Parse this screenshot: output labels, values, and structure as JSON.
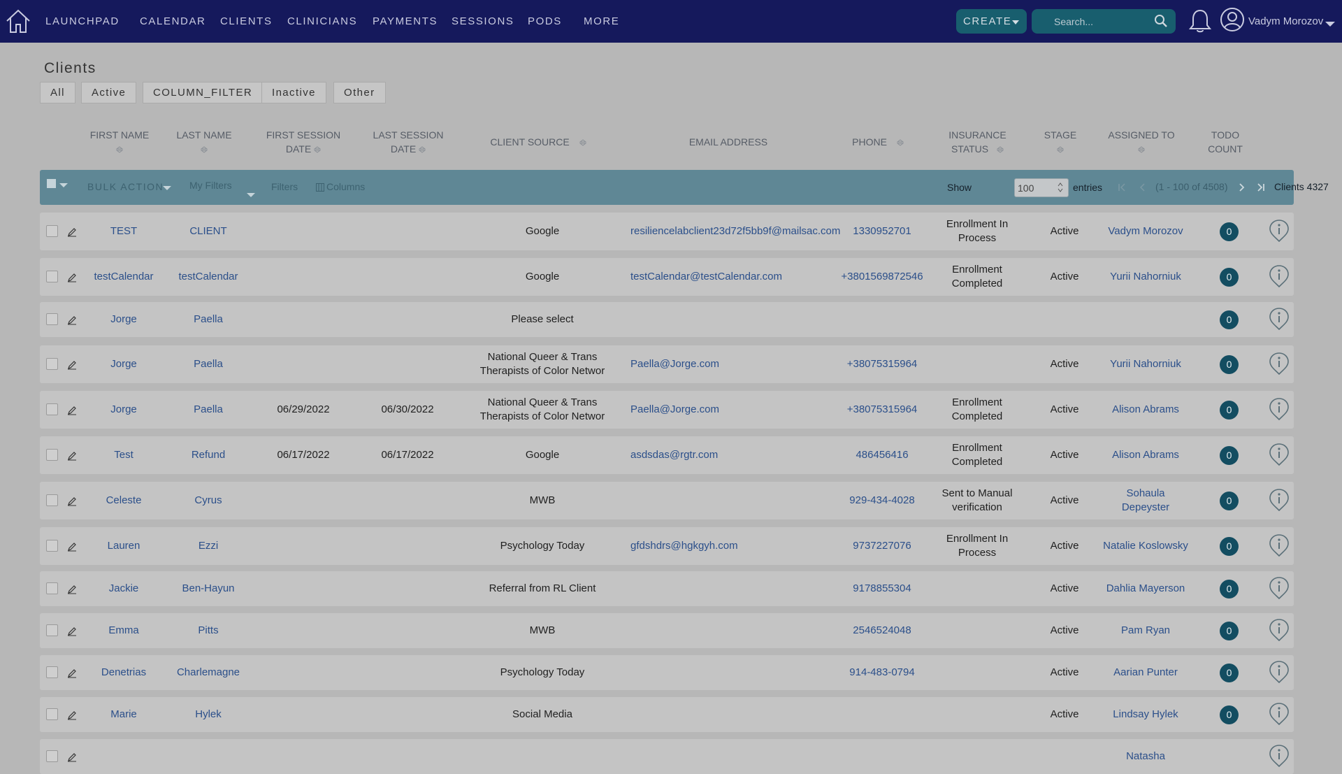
{
  "nav": {
    "items": [
      "LAUNCHPAD",
      "CALENDAR",
      "CLIENTS",
      "CLINICIANS",
      "PAYMENTS",
      "SESSIONS",
      "PODS",
      "MORE"
    ],
    "create_label": "CREATE",
    "search_placeholder": "Search...",
    "user_name": "Vadym Morozov"
  },
  "page": {
    "title": "Clients",
    "filter_tabs": [
      "All",
      "Active",
      "COLUMN_FILTER",
      "Inactive",
      "Other"
    ]
  },
  "columns": {
    "first_name": "FIRST NAME",
    "last_name": "LAST NAME",
    "first_session_1": "FIRST SESSION",
    "first_session_2": "DATE",
    "last_session_1": "LAST SESSION",
    "last_session_2": "DATE",
    "client_source": "CLIENT SOURCE",
    "email": "EMAIL ADDRESS",
    "phone": "PHONE",
    "insurance_1": "INSURANCE",
    "insurance_2": "STATUS",
    "stage": "STAGE",
    "assigned_to": "ASSIGNED TO",
    "todo_1": "TODO",
    "todo_2": "COUNT"
  },
  "toolbar": {
    "bulk_action": "BULK ACTION",
    "my_filters": "My Filters",
    "filters": "Filters",
    "columns": "Columns",
    "show_label": "Show",
    "show_value": "100",
    "entries_label": "entries",
    "range": "(1 - 100 of 4508)",
    "clients_count": "Clients 4327"
  },
  "rows": [
    {
      "first": "TEST",
      "last": "CLIENT",
      "fsd": "",
      "lsd": "",
      "source": [
        "Google"
      ],
      "email": "resiliencelabclient23d72f5bb9f@mailsac.com",
      "phone": "1330952701",
      "insurance": [
        "Enrollment In",
        "Process"
      ],
      "stage": "Active",
      "assigned": [
        "Vadym Morozov"
      ],
      "todo": "0"
    },
    {
      "first": "testCalendar",
      "last": "testCalendar",
      "fsd": "",
      "lsd": "",
      "source": [
        "Google"
      ],
      "email": "testCalendar@testCalendar.com",
      "phone": "+3801569872546",
      "insurance": [
        "Enrollment",
        "Completed"
      ],
      "stage": "Active",
      "assigned": [
        "Yurii Nahorniuk"
      ],
      "todo": "0"
    },
    {
      "first": "Jorge",
      "last": "Paella",
      "fsd": "",
      "lsd": "",
      "source": [
        "Please select"
      ],
      "email": "",
      "phone": "",
      "insurance": [],
      "stage": "",
      "assigned": [],
      "todo": "0"
    },
    {
      "first": "Jorge",
      "last": "Paella",
      "fsd": "",
      "lsd": "",
      "source": [
        "National Queer & Trans",
        "Therapists of Color Networ"
      ],
      "email": "Paella@Jorge.com",
      "phone": "+38075315964",
      "insurance": [],
      "stage": "Active",
      "assigned": [
        "Yurii Nahorniuk"
      ],
      "todo": "0"
    },
    {
      "first": "Jorge",
      "last": "Paella",
      "fsd": "06/29/2022",
      "lsd": "06/30/2022",
      "source": [
        "National Queer & Trans",
        "Therapists of Color Networ"
      ],
      "email": "Paella@Jorge.com",
      "phone": "+38075315964",
      "insurance": [
        "Enrollment",
        "Completed"
      ],
      "stage": "Active",
      "assigned": [
        "Alison Abrams"
      ],
      "todo": "0"
    },
    {
      "first": "Test",
      "last": "Refund",
      "fsd": "06/17/2022",
      "lsd": "06/17/2022",
      "source": [
        "Google"
      ],
      "email": "asdsdas@rgtr.com",
      "phone": "486456416",
      "insurance": [
        "Enrollment",
        "Completed"
      ],
      "stage": "Active",
      "assigned": [
        "Alison Abrams"
      ],
      "todo": "0"
    },
    {
      "first": "Celeste",
      "last": "Cyrus",
      "fsd": "",
      "lsd": "",
      "source": [
        "MWB"
      ],
      "email": "",
      "phone": "929-434-4028",
      "insurance": [
        "Sent to Manual",
        "verification"
      ],
      "stage": "Active",
      "assigned": [
        "Sohaula",
        "Depeyster"
      ],
      "todo": "0"
    },
    {
      "first": "Lauren",
      "last": "Ezzi",
      "fsd": "",
      "lsd": "",
      "source": [
        "Psychology Today"
      ],
      "email": "gfdshdrs@hgkgyh.com",
      "phone": "9737227076",
      "insurance": [
        "Enrollment In",
        "Process"
      ],
      "stage": "Active",
      "assigned": [
        "Natalie Koslowsky"
      ],
      "todo": "0"
    },
    {
      "first": "Jackie",
      "last": "Ben-Hayun",
      "fsd": "",
      "lsd": "",
      "source": [
        "Referral from RL Client"
      ],
      "email": "",
      "phone": "9178855304",
      "insurance": [],
      "stage": "Active",
      "assigned": [
        "Dahlia Mayerson"
      ],
      "todo": "0"
    },
    {
      "first": "Emma",
      "last": "Pitts",
      "fsd": "",
      "lsd": "",
      "source": [
        "MWB"
      ],
      "email": "",
      "phone": "2546524048",
      "insurance": [],
      "stage": "Active",
      "assigned": [
        "Pam Ryan"
      ],
      "todo": "0"
    },
    {
      "first": "Denetrias",
      "last": "Charlemagne",
      "fsd": "",
      "lsd": "",
      "source": [
        "Psychology Today"
      ],
      "email": "",
      "phone": "914-483-0794",
      "insurance": [],
      "stage": "Active",
      "assigned": [
        "Aarian Punter"
      ],
      "todo": "0"
    },
    {
      "first": "Marie",
      "last": "Hylek",
      "fsd": "",
      "lsd": "",
      "source": [
        "Social Media"
      ],
      "email": "",
      "phone": "",
      "insurance": [],
      "stage": "Active",
      "assigned": [
        "Lindsay Hylek"
      ],
      "todo": "0"
    },
    {
      "first": "",
      "last": "",
      "fsd": "",
      "lsd": "",
      "source": [],
      "email": "",
      "phone": "",
      "insurance": [],
      "stage": "",
      "assigned": [
        "Natasha"
      ],
      "todo": ""
    }
  ]
}
